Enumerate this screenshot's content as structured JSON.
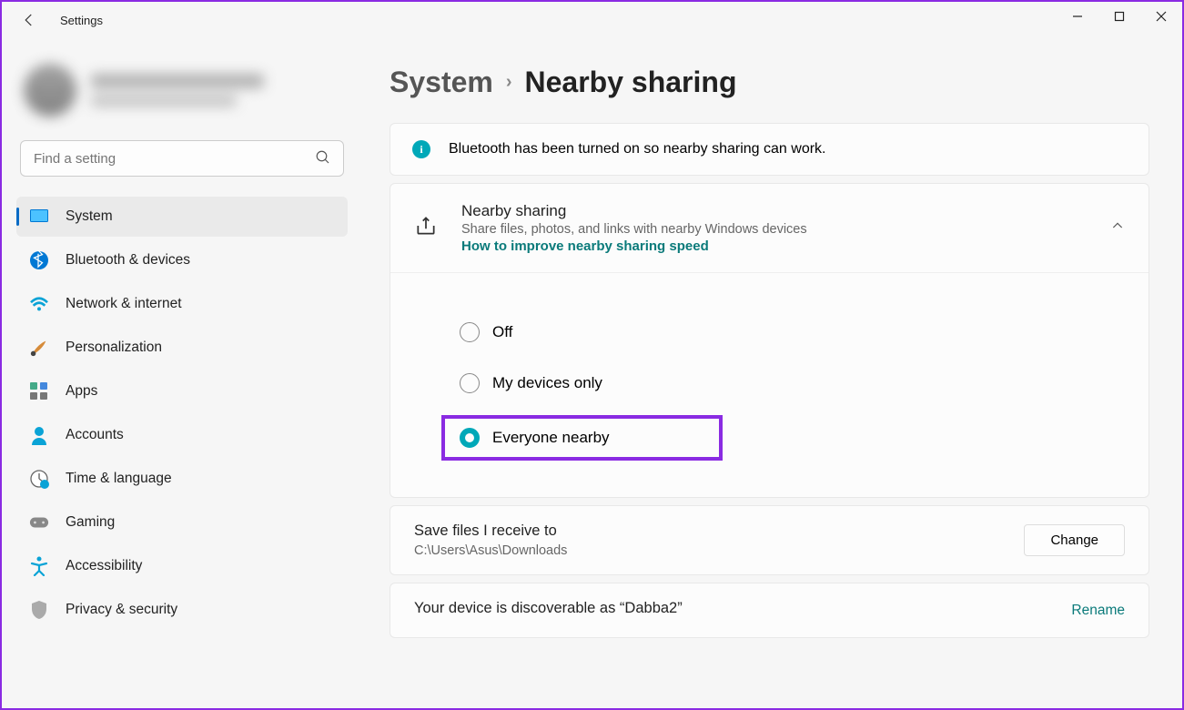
{
  "window": {
    "title": "Settings"
  },
  "search": {
    "placeholder": "Find a setting"
  },
  "sidebar": {
    "items": [
      {
        "label": "System"
      },
      {
        "label": "Bluetooth & devices"
      },
      {
        "label": "Network & internet"
      },
      {
        "label": "Personalization"
      },
      {
        "label": "Apps"
      },
      {
        "label": "Accounts"
      },
      {
        "label": "Time & language"
      },
      {
        "label": "Gaming"
      },
      {
        "label": "Accessibility"
      },
      {
        "label": "Privacy & security"
      }
    ]
  },
  "breadcrumb": {
    "parent": "System",
    "current": "Nearby sharing"
  },
  "banner": {
    "text": "Bluetooth has been turned on so nearby sharing can work."
  },
  "expander": {
    "title": "Nearby sharing",
    "subtitle": "Share files, photos, and links with nearby Windows devices",
    "link": "How to improve nearby sharing speed"
  },
  "radios": {
    "off": "Off",
    "mine": "My devices only",
    "everyone": "Everyone nearby"
  },
  "save": {
    "title": "Save files I receive to",
    "path": "C:\\Users\\Asus\\Downloads",
    "button": "Change"
  },
  "discover": {
    "text": "Your device is discoverable as “Dabba2”",
    "action": "Rename"
  }
}
